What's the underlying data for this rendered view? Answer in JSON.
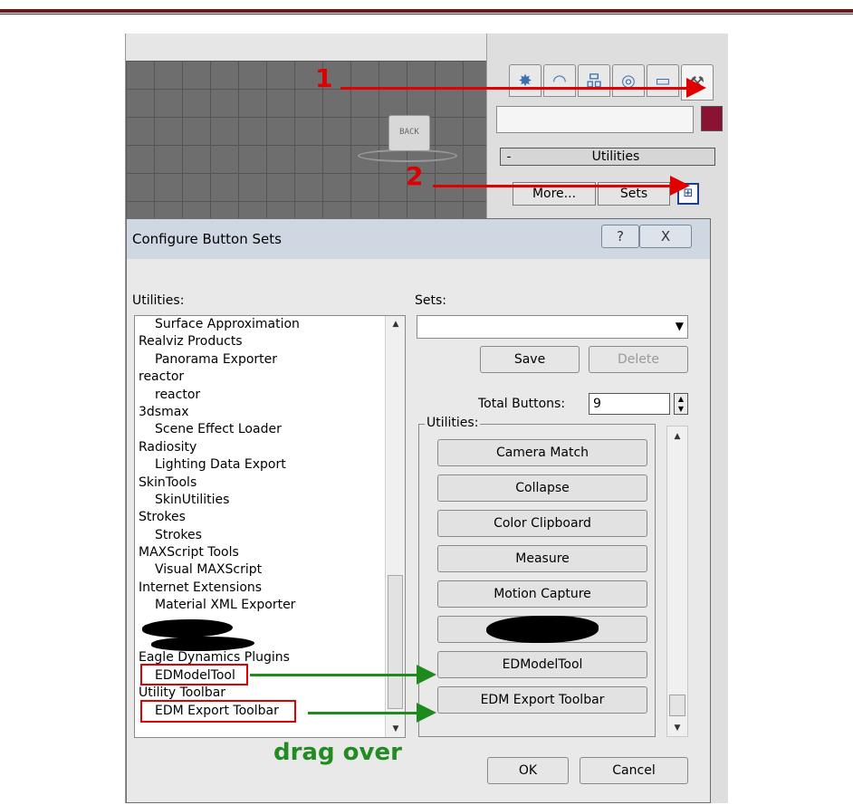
{
  "command_panel": {
    "tab_icons": [
      "create-icon",
      "modify-icon",
      "hierarchy-icon",
      "motion-icon",
      "display-icon",
      "utilities-hammer-icon"
    ],
    "rollout_title": "Utilities",
    "rollout_toggle": "-",
    "more_label": "More...",
    "sets_label": "Sets",
    "swatch_color": "#8a1233"
  },
  "viewcube": {
    "label": "BACK"
  },
  "dialog": {
    "title": "Configure Button Sets",
    "help_label": "?",
    "close_label": "X",
    "utilities_label": "Utilities:",
    "sets_label": "Sets:",
    "save_label": "Save",
    "delete_label": "Delete",
    "total_buttons_label": "Total Buttons:",
    "total_buttons_value": "9",
    "group_title": "Utilities:",
    "ok_label": "OK",
    "cancel_label": "Cancel",
    "utilities_list": [
      {
        "label": "Surface Approximation",
        "level": "child"
      },
      {
        "label": "Realviz Products",
        "level": "cat"
      },
      {
        "label": "Panorama Exporter",
        "level": "child"
      },
      {
        "label": "reactor",
        "level": "cat"
      },
      {
        "label": "reactor",
        "level": "child"
      },
      {
        "label": "3dsmax",
        "level": "cat"
      },
      {
        "label": "Scene Effect Loader",
        "level": "child"
      },
      {
        "label": "Radiosity",
        "level": "cat"
      },
      {
        "label": "Lighting Data Export",
        "level": "child"
      },
      {
        "label": "SkinTools",
        "level": "cat"
      },
      {
        "label": "SkinUtilities",
        "level": "child"
      },
      {
        "label": "Strokes",
        "level": "cat"
      },
      {
        "label": "Strokes",
        "level": "child"
      },
      {
        "label": "MAXScript Tools",
        "level": "cat"
      },
      {
        "label": "Visual MAXScript",
        "level": "child"
      },
      {
        "label": "Internet Extensions",
        "level": "cat"
      },
      {
        "label": "Material XML Exporter",
        "level": "child"
      },
      {
        "label": "",
        "level": "cat"
      },
      {
        "label": "",
        "level": "child"
      },
      {
        "label": "Eagle Dynamics Plugins",
        "level": "cat"
      },
      {
        "label": "EDModelTool",
        "level": "child"
      },
      {
        "label": "Utility Toolbar",
        "level": "cat"
      },
      {
        "label": "EDM Export Toolbar",
        "level": "child"
      }
    ],
    "set_buttons": [
      "Camera Match",
      "Collapse",
      "Color Clipboard",
      "Measure",
      "Motion Capture",
      "",
      "EDModelTool",
      "EDM Export Toolbar"
    ]
  },
  "annotations": {
    "step1": "1",
    "step2": "2",
    "drag_over": "drag over",
    "red": "#e00000",
    "green": "#1e8a1e"
  }
}
